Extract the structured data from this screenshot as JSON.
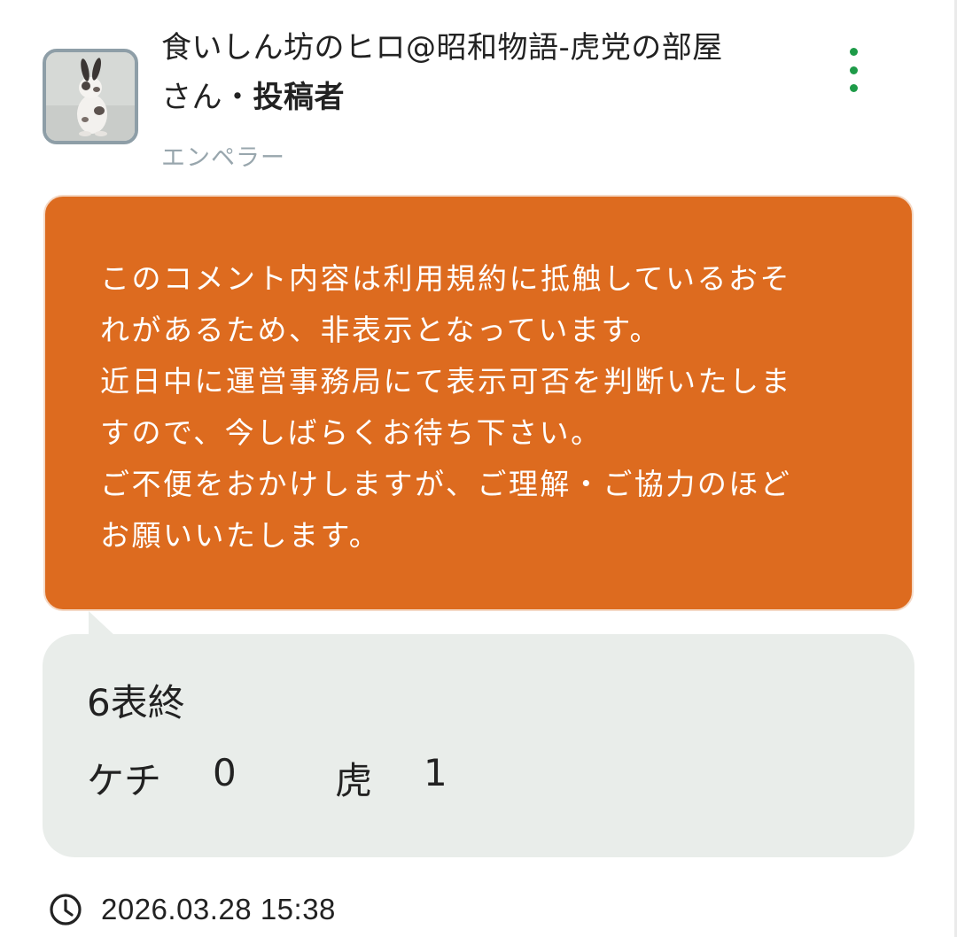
{
  "author": {
    "name": "食いしん坊のヒロ@昭和物語-虎党の部屋",
    "honorific": "さん・",
    "role": "投稿者",
    "rank": "エンペラー"
  },
  "icons": {
    "avatar": "rabbit-photo-avatar",
    "menu": "more-vertical-icon",
    "clock": "clock-icon"
  },
  "notice": {
    "text": "このコメント内容は利用規約に抵触しているおそ\nれがあるため、非表示となっています。\n近日中に運営事務局にて表示可否を判断いたしま\nすので、今しばらくお待ち下さい。\nご不便をおかけしますが、ご理解・ご協力のほど\nお願いいたします。"
  },
  "quote": {
    "inning": "6表終",
    "team1": "ケチ",
    "score1": "0",
    "team2": "虎",
    "score2": "1"
  },
  "timestamp": "2026.03.28 15:38",
  "colors": {
    "notice_bg": "#dd6b1f",
    "quote_bg": "#e9edea",
    "menu_dots": "#1e9b48",
    "rank_text": "#98a6ad",
    "avatar_border": "#8e9ea7"
  }
}
